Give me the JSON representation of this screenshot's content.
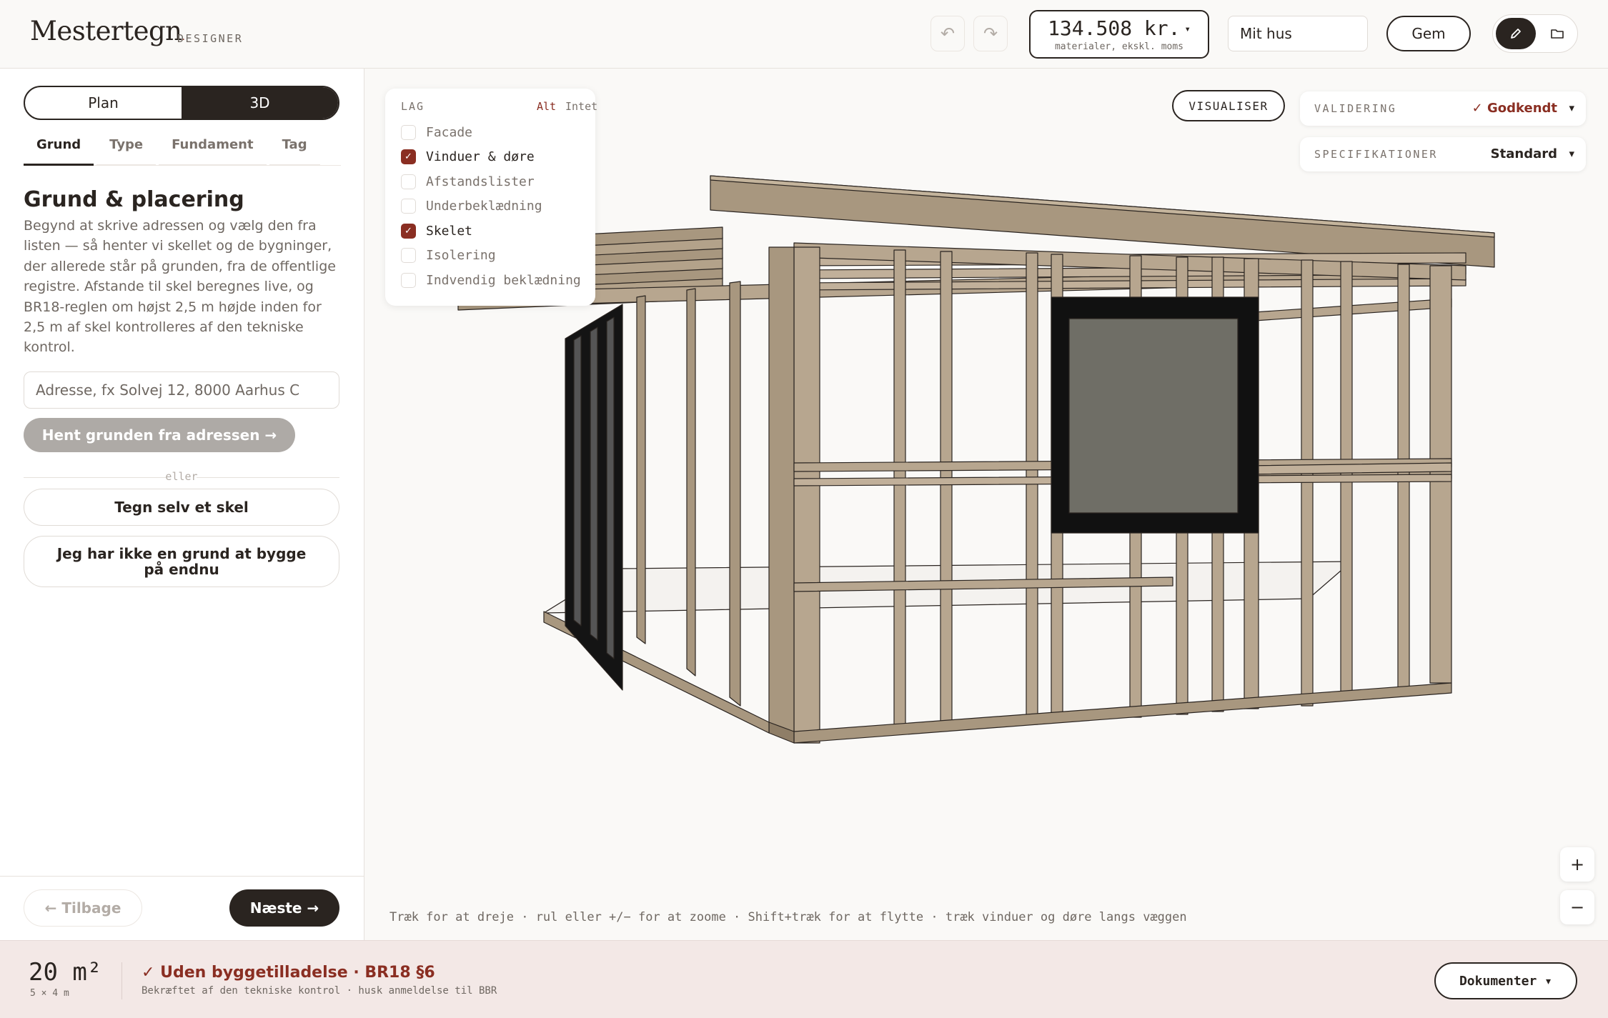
{
  "header": {
    "logo": "Mestertegn",
    "logo_dot": ".",
    "subtitle": "DESIGNER",
    "undo_icon": "↶",
    "redo_icon": "↷",
    "price": "134.508 kr.",
    "price_caret": "▾",
    "price_sub": "materialer, ekskl. moms",
    "project_name": "Mit hus",
    "save_label": "Gem"
  },
  "sidebar": {
    "view_plan": "Plan",
    "view_3d": "3D",
    "tabs": [
      "Grund",
      "Type",
      "Fundament",
      "Tag"
    ],
    "title": "Grund & placering",
    "description": "Begynd at skrive adressen og vælg den fra listen — så henter vi skellet og de bygninger, der allerede står på grunden, fra de offentlige registre. Afstande til skel beregnes live, og BR18-reglen om højst 2,5 m højde inden for 2,5 m af skel kontrolleres af den tekniske kontrol.",
    "address_placeholder": "Adresse, fx Solvej 12, 8000 Aarhus C",
    "fetch_label": "Hent grunden fra adressen →",
    "or_label": "eller",
    "draw_label": "Tegn selv et skel",
    "noplot_label": "Jeg har ikke en grund at bygge på endnu",
    "back_label": "← Tilbage",
    "next_label": "Næste →"
  },
  "layers": {
    "title": "LAG",
    "all": "Alt",
    "none": "Intet",
    "items": [
      {
        "label": "Facade",
        "checked": false
      },
      {
        "label": "Vinduer & døre",
        "checked": true
      },
      {
        "label": "Afstandslister",
        "checked": false
      },
      {
        "label": "Underbeklædning",
        "checked": false
      },
      {
        "label": "Skelet",
        "checked": true
      },
      {
        "label": "Isolering",
        "checked": false
      },
      {
        "label": "Indvendig beklædning",
        "checked": false
      }
    ]
  },
  "viewport": {
    "visualize_label": "VISUALISER",
    "validation_key": "VALIDERING",
    "validation_value": "✓ Godkendt",
    "spec_key": "SPECIFIKATIONER",
    "spec_value": "Standard",
    "caret": "▾",
    "hint": "Træk for at dreje · rul eller +/− for at zoome · Shift+træk for at flytte · træk vinduer og døre langs væggen",
    "zoom_in": "+",
    "zoom_out": "−"
  },
  "status": {
    "area": "20 m²",
    "dims": "5 × 4 m",
    "permit": "✓ Uden byggetilladelse · BR18 §6",
    "permit_sub": "Bekræftet af den tekniske kontrol · husk anmeldelse til BBR",
    "docs_label": "Dokumenter ▾"
  },
  "colors": {
    "accent": "#8a2e22",
    "dark": "#2a2420",
    "wood": "#b7a68f",
    "status_bg": "#f3e8e6"
  }
}
